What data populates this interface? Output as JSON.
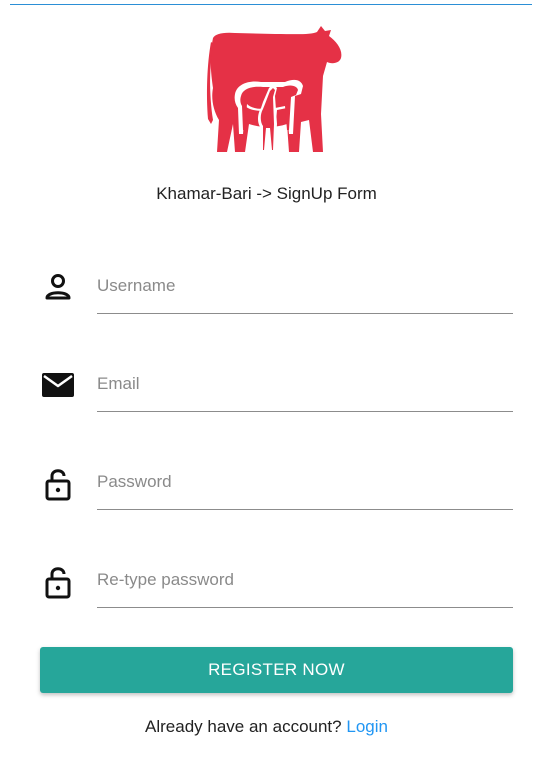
{
  "header": {
    "title": "Khamar-Bari -> SignUp Form",
    "logo_icon": "cattle-logo-icon",
    "logo_color": "#e53146",
    "accent_line_color": "#2b8fd6"
  },
  "form": {
    "username": {
      "placeholder": "Username",
      "value": "",
      "icon": "person-icon"
    },
    "email": {
      "placeholder": "Email",
      "value": "",
      "icon": "envelope-icon"
    },
    "password": {
      "placeholder": "Password",
      "value": "",
      "icon": "lock-icon"
    },
    "retype_password": {
      "placeholder": "Re-type password",
      "value": "",
      "icon": "lock-icon"
    },
    "register_label": "REGISTER NOW",
    "button_color": "#26a69a"
  },
  "footer": {
    "prompt": "Already have an account?",
    "login_label": "Login",
    "link_color": "#2196f3"
  }
}
